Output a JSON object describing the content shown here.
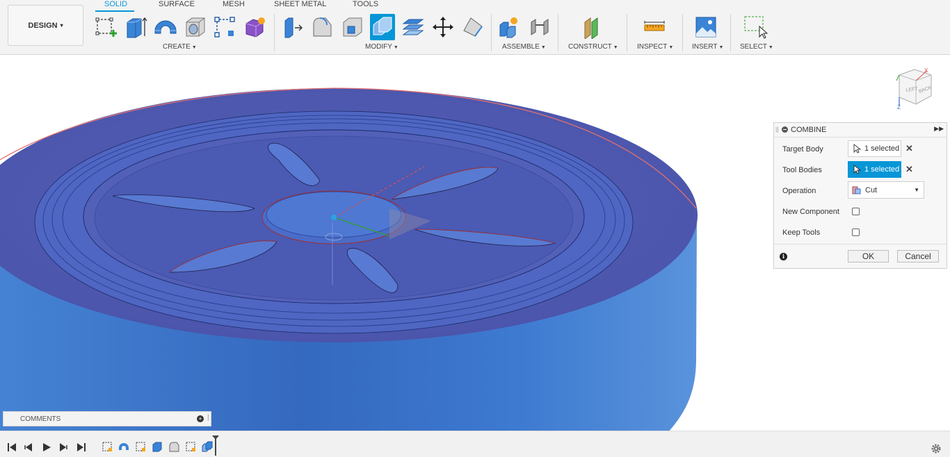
{
  "workspace": {
    "label": "DESIGN",
    "caret": "▾"
  },
  "tabs": [
    {
      "label": "SOLID",
      "active": true
    },
    {
      "label": "SURFACE"
    },
    {
      "label": "MESH"
    },
    {
      "label": "SHEET METAL"
    },
    {
      "label": "TOOLS"
    }
  ],
  "groups": {
    "create": "CREATE",
    "modify": "MODIFY",
    "assemble": "ASSEMBLE",
    "construct": "CONSTRUCT",
    "inspect": "INSPECT",
    "insert": "INSERT",
    "select": "SELECT"
  },
  "tools": [
    "create-sketch-icon",
    "extrude-icon",
    "revolve-icon",
    "hole-icon",
    "pattern-icon",
    "create-form-icon",
    "press-pull-icon",
    "fillet-icon",
    "shell-icon",
    "combine-icon",
    "offset-face-icon",
    "move-icon",
    "draft-icon",
    "new-component-icon",
    "joint-icon",
    "offset-plane-icon",
    "measure-icon",
    "insert-image-icon",
    "select-window-icon"
  ],
  "viewcube": {
    "faces": [
      "TOP",
      "LEFT",
      "BACK"
    ],
    "axes": [
      "X",
      "Y",
      "Z"
    ]
  },
  "combine": {
    "title": "COMBINE",
    "target_body_label": "Target Body",
    "target_body_value": "1 selected",
    "tool_bodies_label": "Tool Bodies",
    "tool_bodies_value": "1 selected",
    "operation_label": "Operation",
    "operation_value": "Cut",
    "new_component_label": "New Component",
    "new_component_checked": false,
    "keep_tools_label": "Keep Tools",
    "keep_tools_checked": false,
    "ok_label": "OK",
    "cancel_label": "Cancel"
  },
  "comments": {
    "label": "COMMENTS"
  },
  "timeline": {
    "controls": [
      "first-icon",
      "previous-icon",
      "play-icon",
      "next-icon",
      "last-icon"
    ],
    "features": [
      "sketch-icon",
      "revolve-icon",
      "sketch-icon",
      "extrude-icon",
      "fillet-icon",
      "sketch-icon",
      "combine-icon"
    ]
  },
  "colors": {
    "accent": "#0696d7",
    "body_top": "#4d58b0",
    "body_side": "#3e78c9",
    "toolbar_bg": "#f3f3f3"
  }
}
